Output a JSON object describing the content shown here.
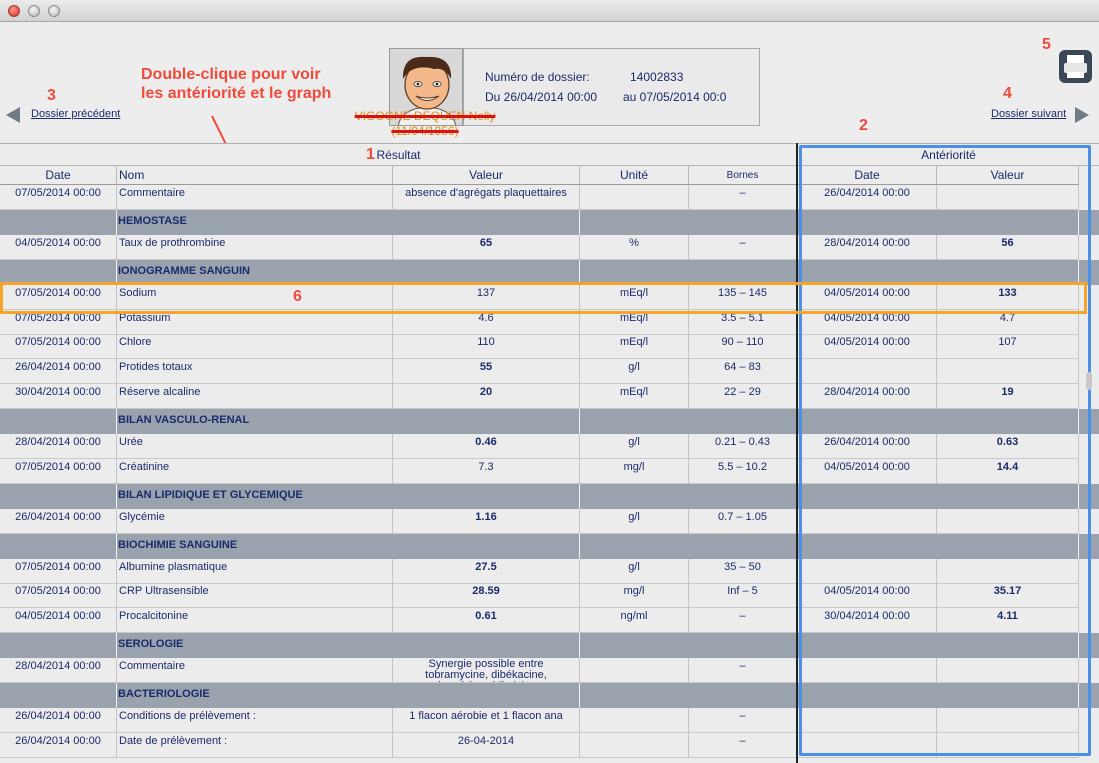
{
  "window": {
    "buttons": [
      "close",
      "minimize",
      "zoom"
    ]
  },
  "header": {
    "dossier_label": "Numéro de dossier:",
    "dossier_number": "14002833",
    "period_label": "Du 26/04/2014 00:00",
    "period_to": "au 07/05/2014 00:0",
    "patient_name": "VIGOGNE DEQUEN Nelly",
    "patient_birth": "(11/04/1956)",
    "prev_label": "Dossier précédent",
    "next_label": "Dossier suivant"
  },
  "annotations": {
    "callout": "Double-clique pour voir les antériorité et le graph",
    "n1": "1",
    "n2": "2",
    "n3": "3",
    "n4": "4",
    "n5": "5",
    "n6": "6"
  },
  "table": {
    "result_title": "Résultat",
    "anteriority_title": "Antériorité",
    "columns": {
      "date": "Date",
      "nom": "Nom",
      "valeur": "Valeur",
      "unite": "Unité",
      "bornes": "Bornes",
      "ant_date": "Date",
      "ant_valeur": "Valeur"
    },
    "rows": [
      {
        "type": "data",
        "date": "07/05/2014 00:00",
        "nom": "Commentaire",
        "valeur": "absence d'agrégats plaquettaires",
        "unite": "",
        "bornes": "–",
        "ant_date": "26/04/2014 00:00",
        "ant_valeur": "",
        "abn": false,
        "ant_abn": false
      },
      {
        "type": "group",
        "label": "HEMOSTASE"
      },
      {
        "type": "data",
        "date": "04/05/2014 00:00",
        "nom": "Taux de prothrombine",
        "valeur": "65",
        "unite": "%",
        "bornes": "–",
        "ant_date": "28/04/2014 00:00",
        "ant_valeur": "56",
        "abn": true,
        "ant_abn": true
      },
      {
        "type": "group",
        "label": "IONOGRAMME SANGUIN"
      },
      {
        "type": "data",
        "date": "07/05/2014 00:00",
        "nom": "Sodium",
        "valeur": "137",
        "unite": "mEq/l",
        "bornes": "135 –  145",
        "ant_date": "04/05/2014 00:00",
        "ant_valeur": "133",
        "abn": false,
        "ant_abn": true
      },
      {
        "type": "data",
        "date": "07/05/2014 00:00",
        "nom": "Potassium",
        "valeur": "4.6",
        "unite": "mEq/l",
        "bornes": "3.5 –  5.1",
        "ant_date": "04/05/2014 00:00",
        "ant_valeur": "4.7",
        "abn": false,
        "ant_abn": false
      },
      {
        "type": "data",
        "date": "07/05/2014 00:00",
        "nom": "Chlore",
        "valeur": "110",
        "unite": "mEq/l",
        "bornes": "90 –  110",
        "ant_date": "04/05/2014 00:00",
        "ant_valeur": "107",
        "abn": false,
        "ant_abn": false
      },
      {
        "type": "data",
        "date": "26/04/2014 00:00",
        "nom": "Protides totaux",
        "valeur": "55",
        "unite": "g/l",
        "bornes": "64 –  83",
        "ant_date": "",
        "ant_valeur": "",
        "abn": true,
        "ant_abn": false
      },
      {
        "type": "data",
        "date": "30/04/2014 00:00",
        "nom": "Réserve alcaline",
        "valeur": "20",
        "unite": "mEq/l",
        "bornes": "22 –  29",
        "ant_date": "28/04/2014 00:00",
        "ant_valeur": "19",
        "abn": true,
        "ant_abn": true
      },
      {
        "type": "group",
        "label": "BILAN VASCULO-RENAL"
      },
      {
        "type": "data",
        "date": "28/04/2014 00:00",
        "nom": "Urée",
        "valeur": "0.46",
        "unite": "g/l",
        "bornes": "0.21 –  0.43",
        "ant_date": "26/04/2014 00:00",
        "ant_valeur": "0.63",
        "abn": true,
        "ant_abn": true
      },
      {
        "type": "data",
        "date": "07/05/2014 00:00",
        "nom": "Créatinine",
        "valeur": "7.3",
        "unite": "mg/l",
        "bornes": "5.5 –  10.2",
        "ant_date": "04/05/2014 00:00",
        "ant_valeur": "14.4",
        "abn": false,
        "ant_abn": true
      },
      {
        "type": "group",
        "label": "BILAN LIPIDIQUE ET GLYCEMIQUE"
      },
      {
        "type": "data",
        "date": "26/04/2014 00:00",
        "nom": "Glycémie",
        "valeur": "1.16",
        "unite": "g/l",
        "bornes": "0.7 –  1.05",
        "ant_date": "",
        "ant_valeur": "",
        "abn": true,
        "ant_abn": false
      },
      {
        "type": "group",
        "label": "BIOCHIMIE SANGUINE"
      },
      {
        "type": "data",
        "date": "07/05/2014 00:00",
        "nom": "Albumine plasmatique",
        "valeur": "27.5",
        "unite": "g/l",
        "bornes": "35 –  50",
        "ant_date": "",
        "ant_valeur": "",
        "abn": true,
        "ant_abn": false
      },
      {
        "type": "data",
        "date": "07/05/2014 00:00",
        "nom": "CRP Ultrasensible",
        "valeur": "28.59",
        "unite": "mg/l",
        "bornes": "Inf –  5",
        "ant_date": "04/05/2014 00:00",
        "ant_valeur": "35.17",
        "abn": true,
        "ant_abn": true
      },
      {
        "type": "data",
        "date": "04/05/2014 00:00",
        "nom": "Procalcitonine",
        "valeur": "0.61",
        "unite": "ng/ml",
        "bornes": "–",
        "ant_date": "30/04/2014 00:00",
        "ant_valeur": "4.11",
        "abn": true,
        "ant_abn": true
      },
      {
        "type": "group",
        "label": "SEROLOGIE"
      },
      {
        "type": "data",
        "date": "28/04/2014 00:00",
        "nom": "Commentaire",
        "valeur": "Synergie possible entre tobramycine, dibékacine, sisomicinenétilmicine,",
        "unite": "",
        "bornes": "–",
        "ant_date": "",
        "ant_valeur": "",
        "abn": false,
        "ant_abn": false
      },
      {
        "type": "group",
        "label": "BACTERIOLOGIE"
      },
      {
        "type": "data",
        "date": "26/04/2014 00:00",
        "nom": "Conditions de prélèvement :",
        "valeur": "1 flacon aérobie et 1 flacon ana",
        "unite": "",
        "bornes": "–",
        "ant_date": "",
        "ant_valeur": "",
        "abn": false,
        "ant_abn": false
      },
      {
        "type": "data",
        "date": "26/04/2014 00:00",
        "nom": "Date de prélèvement  :",
        "valeur": "26-04-2014",
        "unite": "",
        "bornes": "–",
        "ant_date": "",
        "ant_valeur": "",
        "abn": false,
        "ant_abn": false
      }
    ]
  },
  "colors": {
    "abnormal": "#e3141e",
    "group_bg": "#9aa2ad",
    "annotation": "#f04a3c",
    "highlight_orange": "#f4a529",
    "highlight_blue": "#4b8fe6"
  }
}
